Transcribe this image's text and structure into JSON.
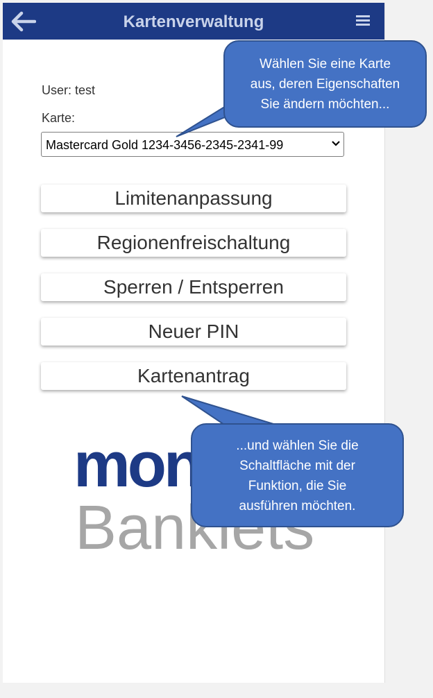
{
  "header": {
    "title": "Kartenverwaltung",
    "back_icon": "arrow-left-icon",
    "menu_icon": "hamburger-menu-icon"
  },
  "user_label": "User: test",
  "card_label": "Karte:",
  "card_select": {
    "value": "Mastercard Gold 1234-3456-2345-2341-99"
  },
  "buttons": [
    {
      "label": "Limitenanpassung"
    },
    {
      "label": "Regionenfreischaltung"
    },
    {
      "label": "Sperren / Entsperren"
    },
    {
      "label": "Neuer PIN"
    },
    {
      "label": "Kartenantrag"
    }
  ],
  "logo": {
    "top": "mon",
    "bottom": "Banklets"
  },
  "callouts": {
    "select_hint": [
      "Wählen Sie eine Karte",
      "aus, deren Eigenschaften",
      "Sie ändern möchten..."
    ],
    "button_hint": [
      "...und wählen Sie die",
      "Schaltfläche mit der",
      "Funktion, die Sie",
      "ausführen möchten."
    ]
  },
  "colors": {
    "header_bg": "#1d3a85",
    "header_text": "#c9d3ea",
    "callout_bg": "#4472c4",
    "logo_blue": "#1d3a85",
    "logo_gray": "#a6a6a6"
  }
}
